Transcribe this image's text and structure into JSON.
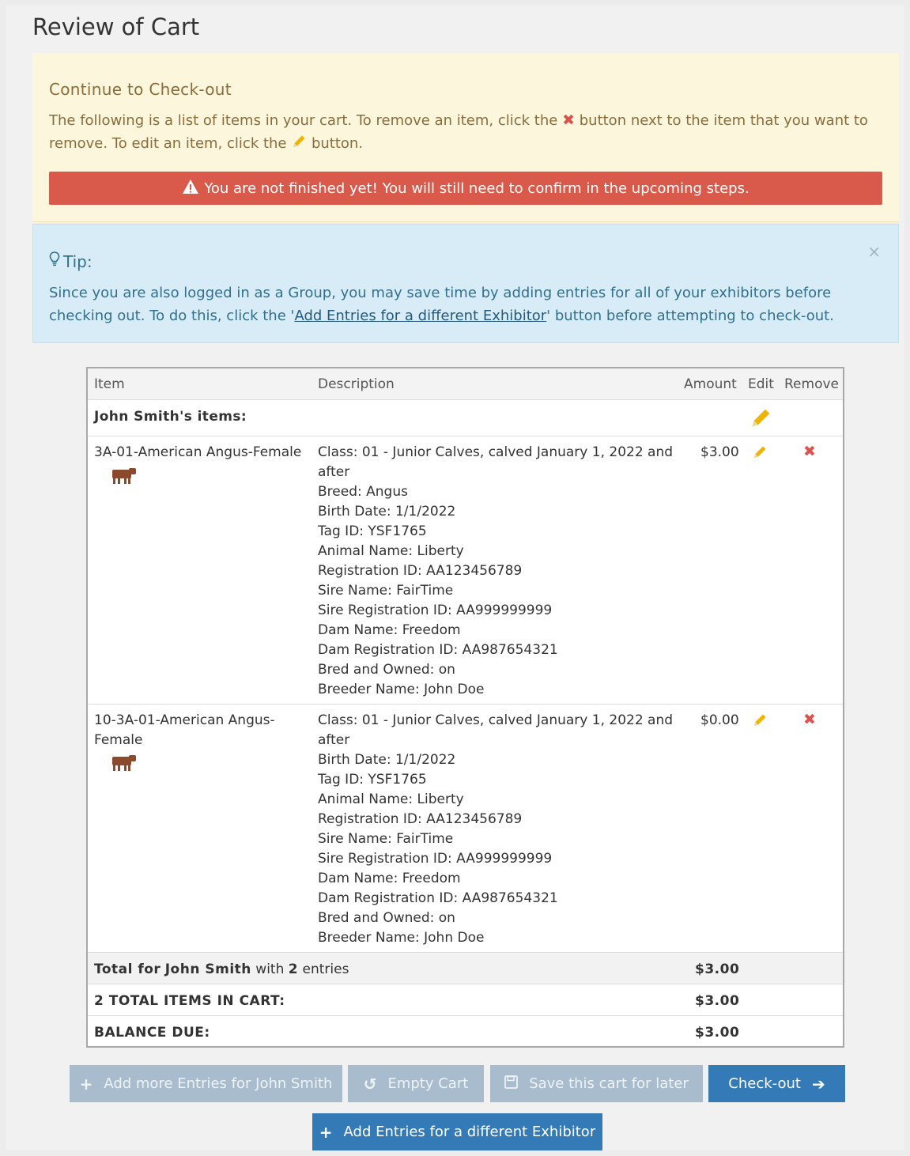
{
  "page": {
    "title": "Review of Cart"
  },
  "notice": {
    "title": "Continue to Check-out",
    "text_1": "The following is a list of items in your cart. To remove an item, click the",
    "text_2": "button next to the item that you want to remove. To edit an item, click the",
    "text_3": "button.",
    "warning": "You are not finished yet! You will still need to confirm in the upcoming steps."
  },
  "tip": {
    "title": "Tip:",
    "text_1": "Since you are also logged in as a Group, you may save time by adding entries for all of your exhibitors before checking out. To do this, click the '",
    "link": "Add Entries for a different Exhibitor",
    "text_2": "' button before attempting to check-out.",
    "close": "×"
  },
  "table": {
    "headers": {
      "item": "Item",
      "description": "Description",
      "amount": "Amount",
      "edit": "Edit",
      "remove": "Remove"
    },
    "group_label": "John Smith's items:",
    "items": [
      {
        "name": "3A-01-American Angus-Female",
        "amount": "$3.00",
        "description": [
          "Class: 01 - Junior Calves, calved January 1, 2022 and",
          "after",
          "Breed: Angus",
          "Birth Date: 1/1/2022",
          "Tag ID: YSF1765",
          "Animal Name: Liberty",
          "Registration ID: AA123456789",
          "Sire Name: FairTime",
          "Sire Registration ID: AA999999999",
          "Dam Name: Freedom",
          "Dam Registration ID: AA987654321",
          "Bred and Owned: on",
          "Breeder Name: John Doe"
        ]
      },
      {
        "name_line1": "10-3A-01-American Angus-",
        "name_line2": "Female",
        "amount": "$0.00",
        "description": [
          "Class: 01 - Junior Calves, calved January 1, 2022 and",
          "after",
          "Birth Date: 1/1/2022",
          "Tag ID: YSF1765",
          "Animal Name: Liberty",
          "Registration ID: AA123456789",
          "Sire Name: FairTime",
          "Sire Registration ID: AA999999999",
          "Dam Name: Freedom",
          "Dam Registration ID: AA987654321",
          "Bred and Owned: on",
          "Breeder Name: John Doe"
        ]
      }
    ],
    "total": {
      "prefix": "Total for",
      "name": "John Smith",
      "with": "with",
      "count": "2",
      "suffix": "entries",
      "amount": "$3.00"
    },
    "items_total": {
      "label": "2 TOTAL ITEMS IN CART:",
      "amount": "$3.00"
    },
    "balance": {
      "label": "BALANCE DUE:",
      "amount": "$3.00"
    }
  },
  "buttons": {
    "add_more": "Add more Entries for John Smith",
    "empty_cart": "Empty Cart",
    "save_later": "Save this cart for later",
    "checkout": "Check-out",
    "add_different": "Add Entries for a different Exhibitor"
  },
  "colors": {
    "primary": "#337ab7",
    "muted": "#a9bccd",
    "danger": "#d9594a",
    "warning_bg": "#fcf6dd",
    "info_bg": "#d7ecf6",
    "pencil": "#f0b400",
    "remove": "#d9534f",
    "cow": "#8b4a2b"
  }
}
